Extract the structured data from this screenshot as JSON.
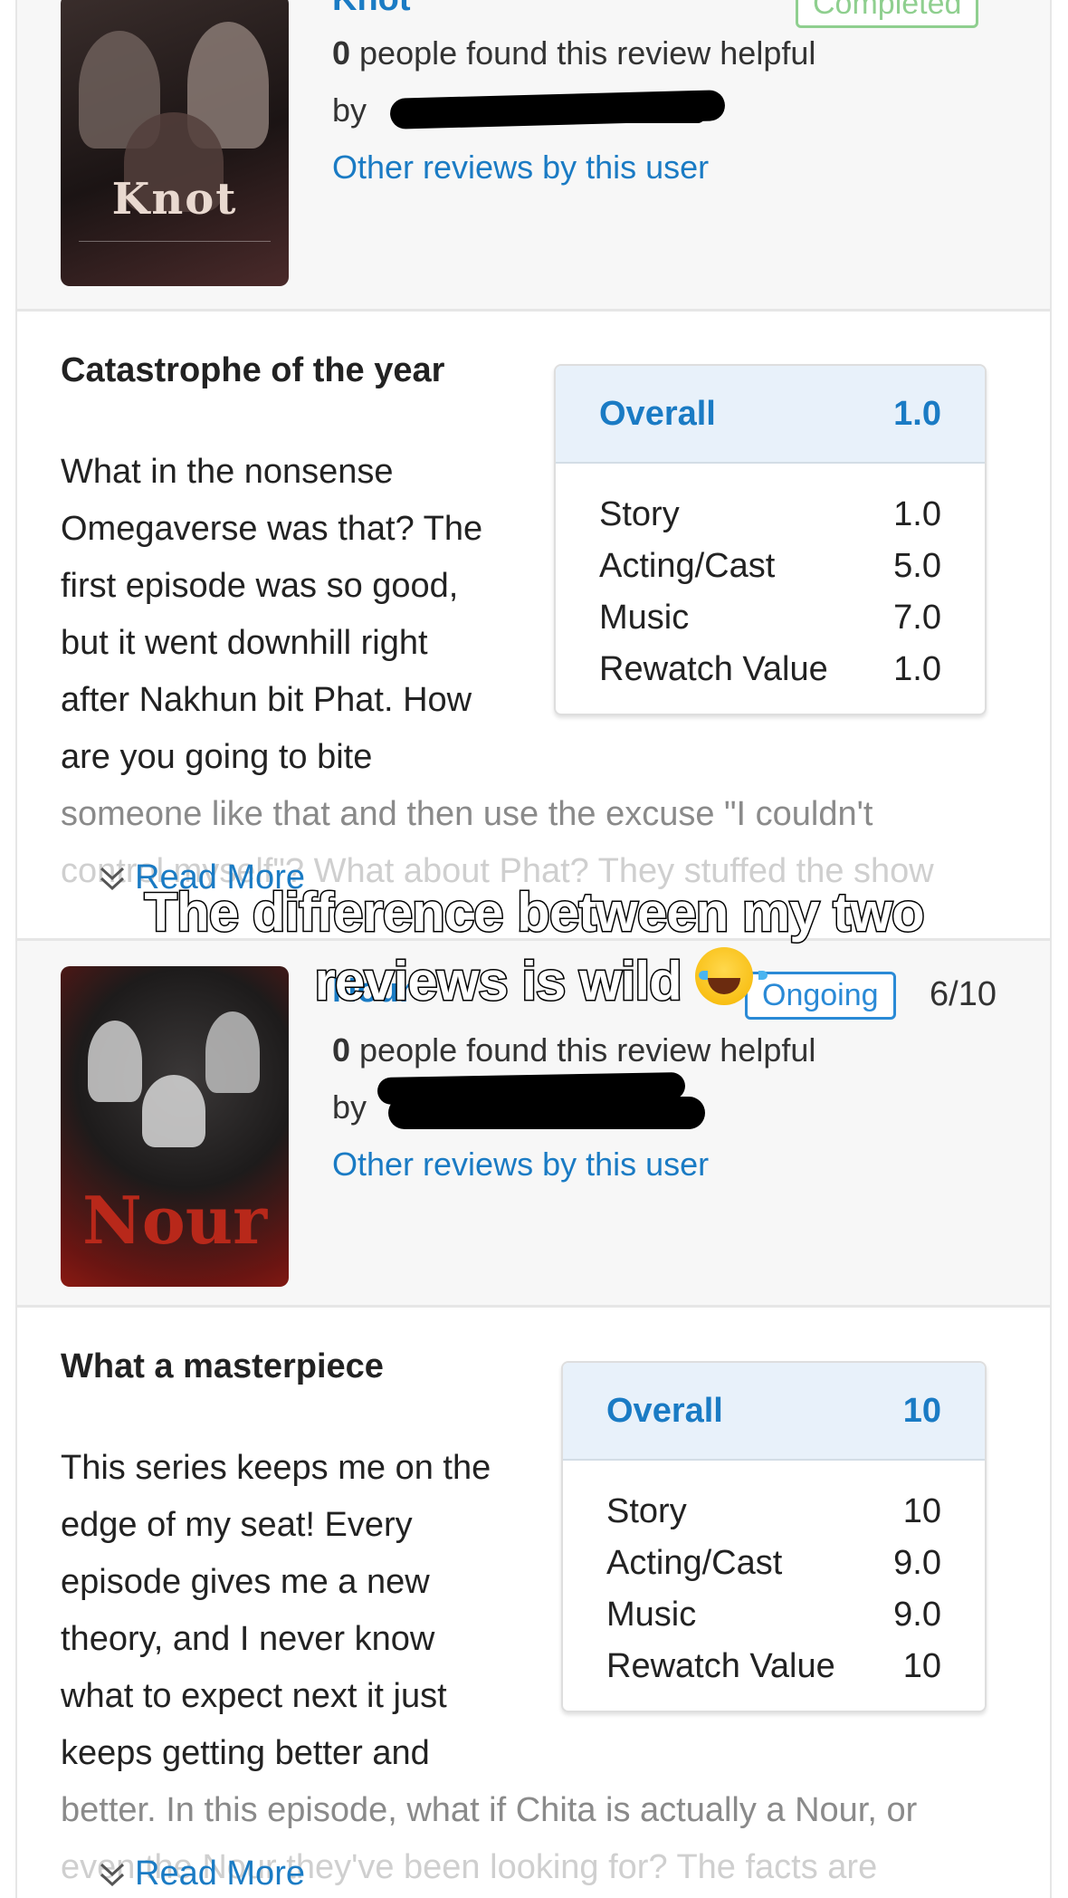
{
  "review1": {
    "drama_title": "Knot",
    "status": "Completed",
    "helpful_count": "0",
    "helpful_text": " people found this review helpful",
    "by_label": "by",
    "other_reviews_link": "Other reviews by this user",
    "poster_text": "Knot",
    "review_title": "Catastrophe of the year",
    "body_lines": [
      "What in the nonsense",
      "Omegaverse was that? The",
      "first episode was so good,",
      "but it went downhill right",
      "after Nakhun bit Phat. How",
      "are you going to bite"
    ],
    "body_wide_line_1": "someone like that and then use the excuse \"I couldn't",
    "body_wide_line_2": "control myself\"? What about Phat? They stuffed the show",
    "read_more": "Read More",
    "ratings": {
      "overall_label": "Overall",
      "overall_value": "1.0",
      "rows": [
        {
          "label": "Story",
          "value": "1.0"
        },
        {
          "label": "Acting/Cast",
          "value": "5.0"
        },
        {
          "label": "Music",
          "value": "7.0"
        },
        {
          "label": "Rewatch Value",
          "value": "1.0"
        }
      ]
    }
  },
  "review2": {
    "drama_title": "Nour",
    "status": "Ongoing",
    "episode_score": "6/10",
    "helpful_count": "0",
    "helpful_text": " people found this review helpful",
    "by_label": "by",
    "other_reviews_link": "Other reviews by this user",
    "poster_text": "Nour",
    "review_title": "What a masterpiece",
    "body_lines": [
      "This series keeps me on the",
      "edge of my seat! Every",
      "episode gives me a new",
      "theory, and I never know",
      "what to expect next it just",
      "keeps getting better and"
    ],
    "body_wide_line_1": "better. In this episode, what if Chita is actually a Nour, or",
    "body_wide_line_2": "even the Nour they've been looking for? The facts are",
    "read_more": "Read More",
    "ratings": {
      "overall_label": "Overall",
      "overall_value": "10",
      "rows": [
        {
          "label": "Story",
          "value": "10"
        },
        {
          "label": "Acting/Cast",
          "value": "9.0"
        },
        {
          "label": "Music",
          "value": "9.0"
        },
        {
          "label": "Rewatch Value",
          "value": "10"
        }
      ]
    }
  },
  "overlay": {
    "caption_line_1": "The difference between my two",
    "caption_line_2": "reviews is wild",
    "emoji": "face-with-tears-of-joy"
  },
  "colors": {
    "link_blue": "#1a7bc4",
    "completed_green": "#8fcf8f",
    "ongoing_blue": "#2a8ad6",
    "rating_header_bg": "#e8f1fa"
  }
}
